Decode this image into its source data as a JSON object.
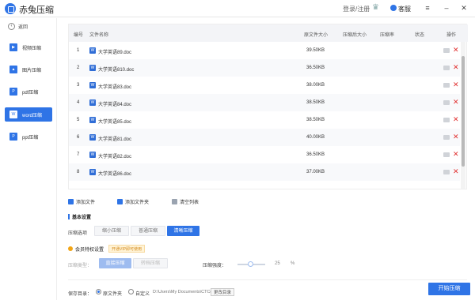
{
  "app": {
    "title": "赤兔压缩"
  },
  "titlebar": {
    "login": "登录/注册",
    "service": "客服",
    "menu_glyph": "≡",
    "minimize_glyph": "–",
    "close_glyph": "✕"
  },
  "sidebar": {
    "back_label": "返回",
    "items": [
      {
        "label": "视频压缩",
        "icon": "video-icon"
      },
      {
        "label": "图片压缩",
        "icon": "image-icon"
      },
      {
        "label": "pdf压缩",
        "icon": "pdf-icon"
      },
      {
        "label": "word压缩",
        "icon": "word-icon",
        "active": true
      },
      {
        "label": "ppt压缩",
        "icon": "ppt-icon"
      }
    ]
  },
  "table": {
    "headers": {
      "index": "编号",
      "name": "文件名称",
      "orig_size": "原文件大小",
      "new_size": "压缩后大小",
      "ratio": "压缩率",
      "status": "状态",
      "ops": "操作"
    },
    "rows": [
      {
        "index": "1",
        "name": "大学英语89.doc",
        "size": "39.50KB"
      },
      {
        "index": "2",
        "name": "大学英语810.doc",
        "size": "36.50KB"
      },
      {
        "index": "3",
        "name": "大学英语83.doc",
        "size": "38.00KB"
      },
      {
        "index": "4",
        "name": "大学英语84.doc",
        "size": "38.50KB"
      },
      {
        "index": "5",
        "name": "大学英语85.doc",
        "size": "38.50KB"
      },
      {
        "index": "6",
        "name": "大学英语81.doc",
        "size": "40.00KB"
      },
      {
        "index": "7",
        "name": "大学英语82.doc",
        "size": "36.50KB"
      },
      {
        "index": "8",
        "name": "大学英语86.doc",
        "size": "37.00KB"
      }
    ]
  },
  "actions": {
    "add_file": "添加文件",
    "add_folder": "添加文件夹",
    "clear_list": "清空列表"
  },
  "basic": {
    "title": "基本设置",
    "option_label": "压缩选项",
    "options": [
      "缩小压缩",
      "普通压缩",
      "清晰压缩"
    ],
    "selected": "清晰压缩"
  },
  "vip": {
    "title": "会员特权设置",
    "tag": "开通VIP即可使用",
    "type_label": "压缩类型：",
    "types": [
      "直接压缩",
      "转档压缩"
    ],
    "level_label": "压缩强度：",
    "level_value": "25",
    "level_unit": "%"
  },
  "output": {
    "label": "保存目录：",
    "option_original": "原文件夹",
    "option_custom": "自定义",
    "path": "D:\\Users\\My Documents\\CTComp",
    "change_button": "更改目录",
    "start_button": "开始压缩"
  },
  "colors": {
    "accent": "#2f74e6",
    "delete": "#e03030",
    "vip": "#d48a1c"
  }
}
